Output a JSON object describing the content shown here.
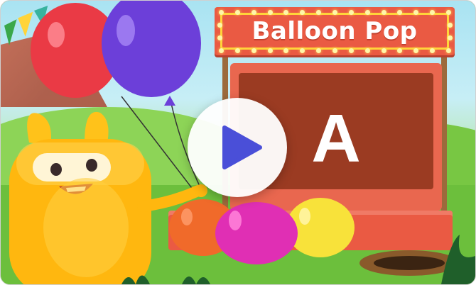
{
  "game": {
    "title": "Balloon Pop",
    "booth_letter": "A"
  },
  "colors": {
    "sign": "#ea5a43",
    "sign_border": "#ffd43a",
    "play_icon": "#4a4fd8",
    "monster": "#ffc21a"
  },
  "icons": {
    "play": "play-triangle-icon"
  }
}
